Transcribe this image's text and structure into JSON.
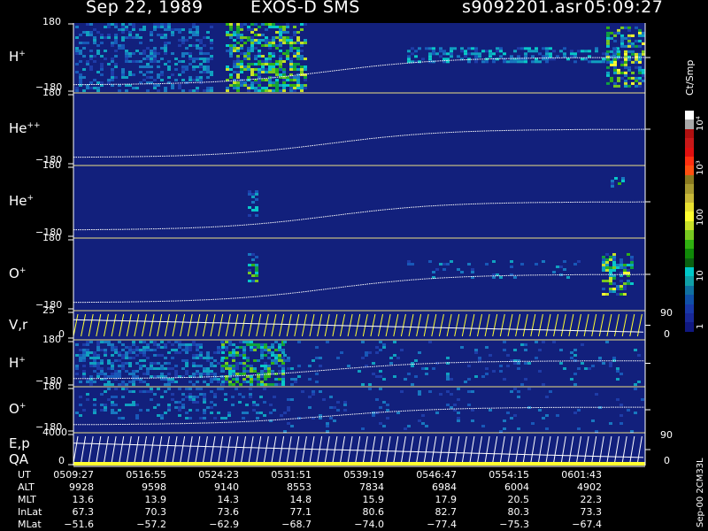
{
  "header": {
    "date": "Sep 22, 1989",
    "title": "EXOS-D SMS",
    "file": "s9092201.asr",
    "time": "05:09:27"
  },
  "colors": {
    "background": "#000000",
    "panel_fill": "#12207c",
    "trace": "#ffffff",
    "trace_yellow": "#ffff30"
  },
  "panels": [
    {
      "label": "H",
      "sup": "+",
      "ymax": "180",
      "ymin": "−180",
      "kind": "spec",
      "intensity": "high"
    },
    {
      "label": "He",
      "sup": "++",
      "ymax": "180",
      "ymin": "−180",
      "kind": "spec",
      "intensity": "none"
    },
    {
      "label": "He",
      "sup": "+",
      "ymax": "180",
      "ymin": "−180",
      "kind": "spec",
      "intensity": "low"
    },
    {
      "label": "O",
      "sup": "+",
      "ymax": "180",
      "ymin": "−180",
      "kind": "spec",
      "intensity": "mid"
    },
    {
      "label": "V,r",
      "sup": "",
      "ymax": "25",
      "ymin": "0",
      "right_top": "90",
      "right_bottom": "0",
      "kind": "line"
    },
    {
      "label": "H",
      "sup": "+",
      "ymax": "180",
      "ymin": "−180",
      "kind": "spec",
      "intensity": "high2"
    },
    {
      "label": "O",
      "sup": "+",
      "ymax": "180",
      "ymin": "−180",
      "kind": "spec",
      "intensity": "mid2"
    },
    {
      "label": "E,p",
      "label2": "QA",
      "sup": "",
      "ymax": "4000",
      "ymin": "0",
      "right_top": "90",
      "right_bottom": "0",
      "kind": "line2"
    }
  ],
  "colorbar": {
    "unit": "Ct/Smp",
    "ticks": [
      "1",
      "10",
      "100",
      "10³",
      "10⁴"
    ],
    "colors": [
      "#ffffff",
      "#a8a8a8",
      "#b01010",
      "#c81818",
      "#e01010",
      "#ff3010",
      "#ff5010",
      "#8a7a20",
      "#a89a30",
      "#c8b838",
      "#e8e030",
      "#ffff30",
      "#c8e028",
      "#78c820",
      "#30b010",
      "#108808",
      "#0a6010",
      "#00c8c8",
      "#10a0a8",
      "#1070a0",
      "#1050a8",
      "#1838a8",
      "#182898",
      "#101880"
    ]
  },
  "orbit": {
    "labels": [
      "UT",
      "ALT",
      "MLT",
      "InLat",
      "MLat"
    ],
    "columns": [
      {
        "UT": "0509:27",
        "ALT": "9928",
        "MLT": "13.6",
        "InLat": "67.3",
        "MLat": "−51.6"
      },
      {
        "UT": "0516:55",
        "ALT": "9598",
        "MLT": "13.9",
        "InLat": "70.3",
        "MLat": "−57.2"
      },
      {
        "UT": "0524:23",
        "ALT": "9140",
        "MLT": "14.3",
        "InLat": "73.6",
        "MLat": "−62.9"
      },
      {
        "UT": "0531:51",
        "ALT": "8553",
        "MLT": "14.8",
        "InLat": "77.1",
        "MLat": "−68.7"
      },
      {
        "UT": "0539:19",
        "ALT": "7834",
        "MLT": "15.9",
        "InLat": "80.6",
        "MLat": "−74.0"
      },
      {
        "UT": "0546:47",
        "ALT": "6984",
        "MLT": "17.9",
        "InLat": "82.7",
        "MLat": "−77.4"
      },
      {
        "UT": "0554:15",
        "ALT": "6004",
        "MLT": "20.5",
        "InLat": "80.3",
        "MLat": "−75.3"
      },
      {
        "UT": "0601:43",
        "ALT": "4902",
        "MLT": "22.3",
        "InLat": "73.3",
        "MLat": "−67.4"
      }
    ]
  },
  "footer": {
    "version": "Sep-00 2CM33L"
  },
  "chart_data": {
    "type": "heatmap",
    "title": "Sep 22, 1989   EXOS-D SMS",
    "x_axis": "UT",
    "x_ticks": [
      "0509:27",
      "0516:55",
      "0524:23",
      "0531:51",
      "0539:19",
      "0546:47",
      "0554:15",
      "0601:43"
    ],
    "series": [
      {
        "name": "H+",
        "ylim": [
          -180,
          180
        ]
      },
      {
        "name": "He++",
        "ylim": [
          -180,
          180
        ]
      },
      {
        "name": "He+",
        "ylim": [
          -180,
          180
        ]
      },
      {
        "name": "O+",
        "ylim": [
          -180,
          180
        ]
      },
      {
        "name": "V,r",
        "ylim": [
          0,
          25
        ]
      },
      {
        "name": "H+",
        "ylim": [
          -180,
          180
        ]
      },
      {
        "name": "O+",
        "ylim": [
          -180,
          180
        ]
      },
      {
        "name": "E,p",
        "ylim": [
          0,
          4000
        ]
      }
    ],
    "colorbar_unit": "Ct/Smp",
    "colorbar_ticks": [
      "1",
      "10",
      "100",
      "10³",
      "10⁴"
    ]
  }
}
